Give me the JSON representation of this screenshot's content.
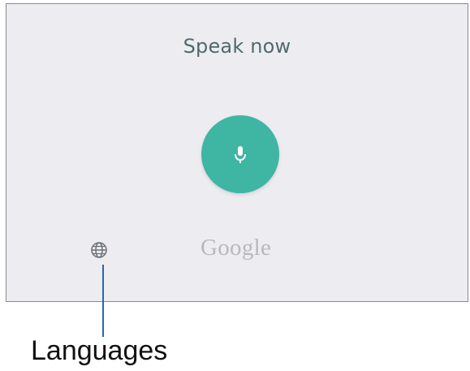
{
  "voice_search": {
    "prompt": "Speak now",
    "mic_icon": "microphone-icon",
    "language_icon": "globe-icon",
    "brand": "Google"
  },
  "callout": {
    "label": "Languages"
  },
  "colors": {
    "panel_background": "#ededf1",
    "panel_border": "#8a8a8a",
    "mic_button": "#3fb5a4",
    "prompt_text": "#4f6a6e",
    "brand_text": "#b9b9bd",
    "callout_line": "#2a66b1"
  }
}
